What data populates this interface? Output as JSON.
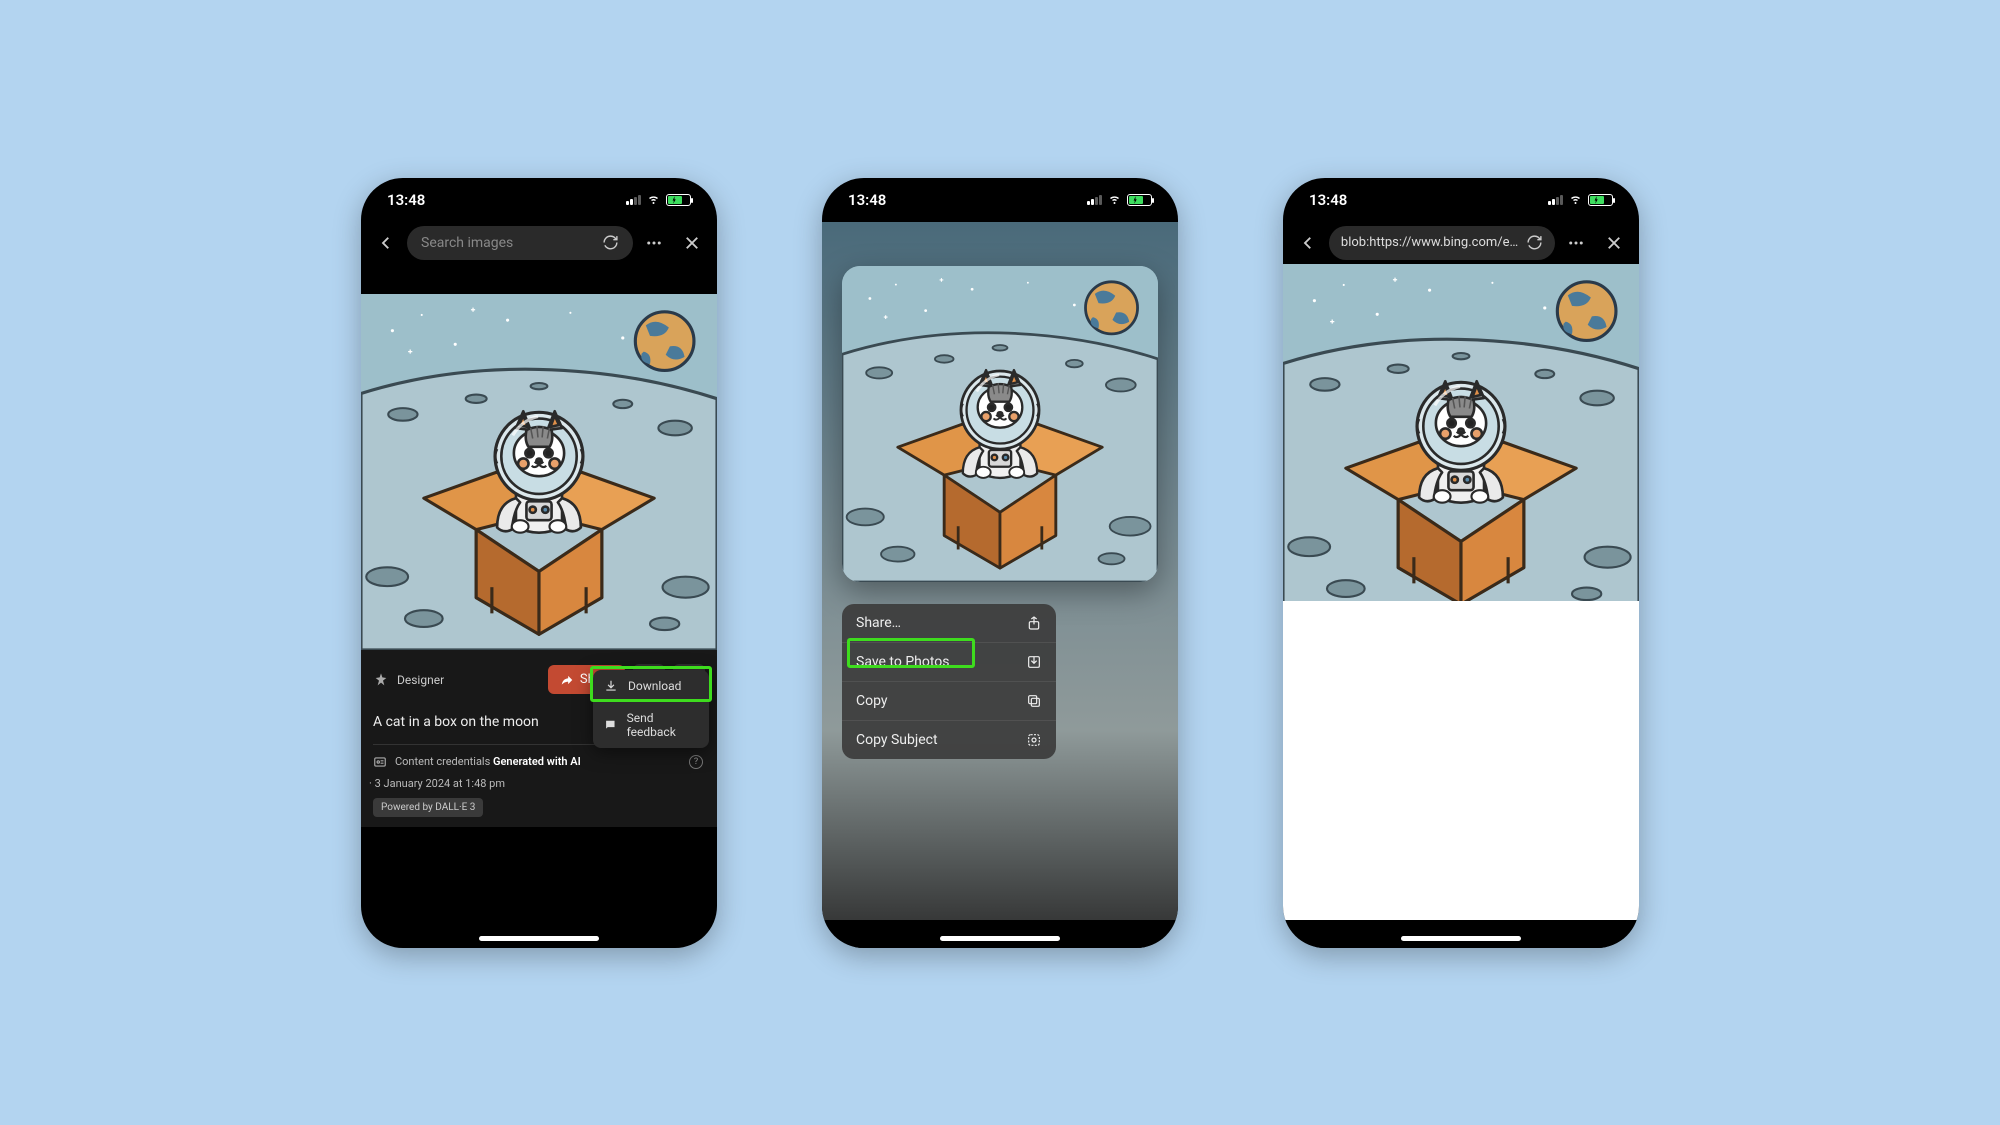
{
  "status": {
    "time": "13:48"
  },
  "phone1": {
    "search_placeholder": "Search images",
    "dropdown": {
      "download": "Download",
      "feedback": "Send feedback"
    },
    "designer_label": "Designer",
    "share_label": "Share",
    "prompt": "A cat in a box on the moon",
    "credentials_title": "Content credentials",
    "generated_with": "Generated with AI",
    "gen_sep": " · ",
    "generated_date": "3 January 2024 at 1:48 pm",
    "dalle_badge": "Powered by DALL·E 3"
  },
  "phone2": {
    "menu": {
      "share": "Share…",
      "save": "Save to Photos",
      "copy": "Copy",
      "copy_subject": "Copy Subject"
    }
  },
  "phone3": {
    "url": "blob:https://www.bing.com/e…"
  }
}
